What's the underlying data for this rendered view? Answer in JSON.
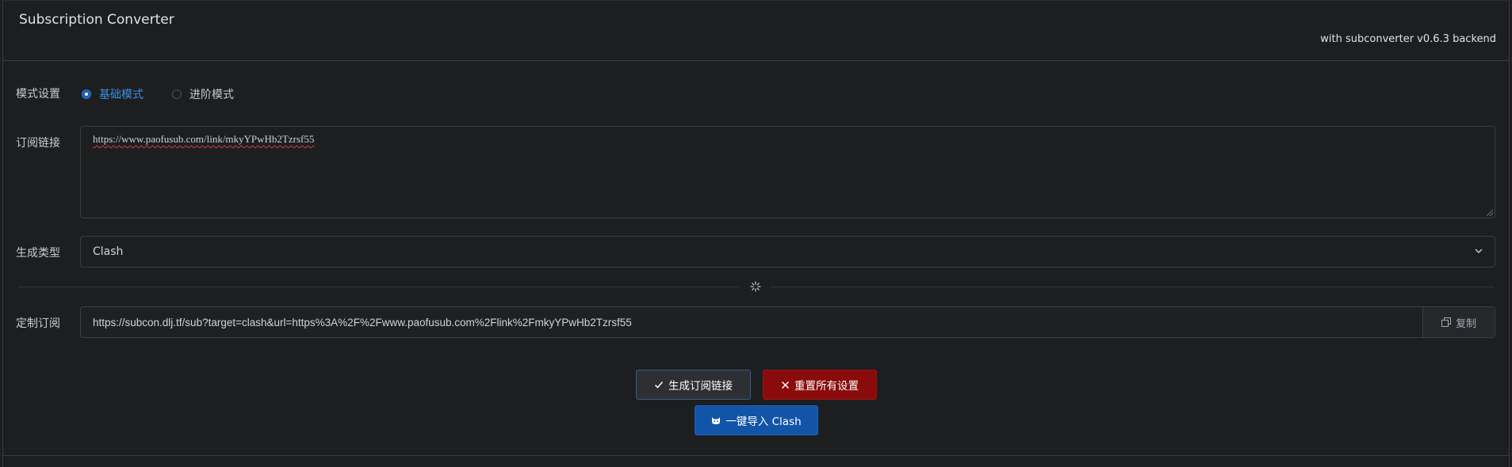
{
  "header": {
    "title": "Subscription Converter",
    "backend": "with subconverter v0.6.3 backend"
  },
  "mode": {
    "label": "模式设置",
    "options": [
      {
        "label": "基础模式",
        "selected": true
      },
      {
        "label": "进阶模式",
        "selected": false
      }
    ]
  },
  "subscription": {
    "label": "订阅链接",
    "value": "https://www.paofusub.com/link/mkyYPwHb2Tzrsf55"
  },
  "target": {
    "label": "生成类型",
    "selected": "Clash",
    "icon": "chevron-down-icon"
  },
  "divider": {
    "icon": "sparkle-loading-icon"
  },
  "custom": {
    "label": "定制订阅",
    "value": "https://subcon.dlj.tf/sub?target=clash&url=https%3A%2F%2Fwww.paofusub.com%2Flink%2FmkyYPwHb2Tzrsf55",
    "copy_label": "复制",
    "copy_icon": "copy-icon"
  },
  "actions": {
    "generate_label": "生成订阅链接",
    "reset_label": "重置所有设置",
    "import_label": "一键导入 Clash"
  },
  "colors": {
    "background": "#1d1e20",
    "accent": "#3d8fe8",
    "danger": "#8a0b0b",
    "primary": "#1254a8"
  }
}
